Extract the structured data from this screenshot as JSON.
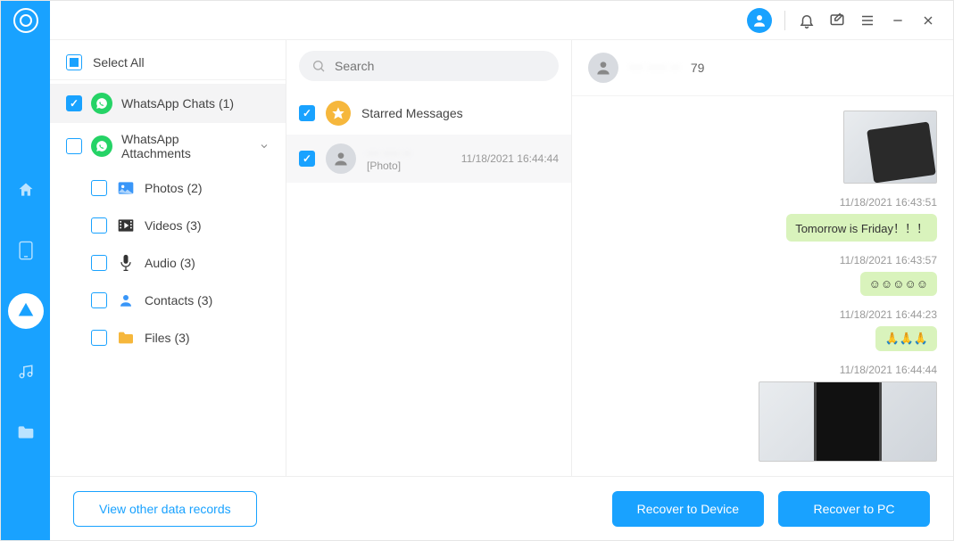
{
  "sidebar": {
    "select_all_label": "Select All",
    "items": {
      "chats": {
        "label": "WhatsApp Chats (1)",
        "checked": true
      },
      "attachments": {
        "label": "WhatsApp Attachments",
        "checked": false,
        "expanded": true
      },
      "photos": {
        "label": "Photos (2)"
      },
      "videos": {
        "label": "Videos (3)"
      },
      "audio": {
        "label": "Audio (3)"
      },
      "contacts": {
        "label": "Contacts (3)"
      },
      "files": {
        "label": "Files (3)"
      }
    }
  },
  "search": {
    "placeholder": "Search"
  },
  "list": {
    "starred_label": "Starred Messages",
    "conv1": {
      "name_hidden": "··· ···· ··",
      "subtitle": "[Photo]",
      "timestamp": "11/18/2021 16:44:44"
    }
  },
  "conversation": {
    "header_id": "··· ···· ··",
    "header_suffix": "79",
    "messages": {
      "m1": {
        "ts": "11/18/2021 16:43:51",
        "text": "Tomorrow is Friday！！！"
      },
      "m2": {
        "ts": "11/18/2021 16:43:57",
        "text": "☺☺☺☺☺"
      },
      "m3": {
        "ts": "11/18/2021 16:44:23",
        "text": "🙏🙏🙏"
      },
      "m4": {
        "ts": "11/18/2021 16:44:44"
      }
    }
  },
  "footer": {
    "view_other": "View other data records",
    "recover_device": "Recover to Device",
    "recover_pc": "Recover to PC"
  }
}
